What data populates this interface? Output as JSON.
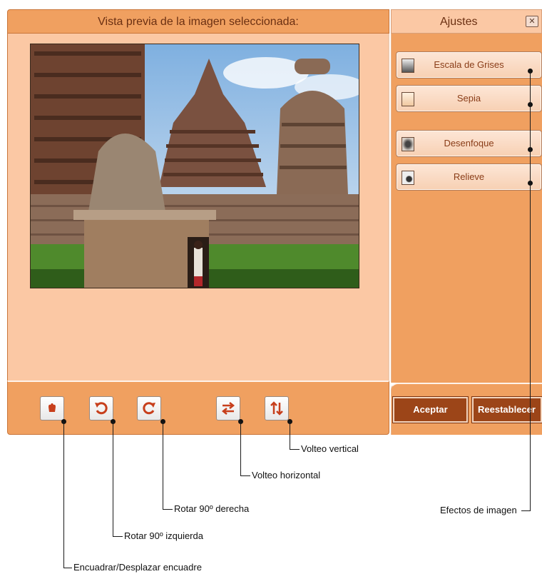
{
  "preview": {
    "title": "Vista previa de la imagen seleccionada:"
  },
  "settings": {
    "title": "Ajustes",
    "close_glyph": "✕",
    "effects": [
      {
        "label": "Escala de Grises",
        "icon": "grayscale-icon"
      },
      {
        "label": "Sepia",
        "icon": "sepia-icon"
      },
      {
        "label": "Desenfoque",
        "icon": "blur-icon"
      },
      {
        "label": "Relieve",
        "icon": "emboss-icon"
      }
    ],
    "accept_label": "Aceptar",
    "reset_label": "Reestablecer"
  },
  "toolbar": {
    "crop_icon": "crop-pan-icon",
    "rotate_left_icon": "rotate-left-icon",
    "rotate_right_icon": "rotate-right-icon",
    "flip_h_icon": "flip-horizontal-icon",
    "flip_v_icon": "flip-vertical-icon"
  },
  "annotations": {
    "flip_vertical": "Volteo vertical",
    "flip_horizontal": "Volteo horizontal",
    "rotate_right": "Rotar 90º derecha",
    "rotate_left": "Rotar 90º izquierda",
    "crop": "Encuadrar/Desplazar encuadre",
    "effects": "Efectos de imagen"
  },
  "colors": {
    "panel_orange": "#f0a060",
    "panel_peach": "#fbc8a4",
    "button_brown": "#9c4518",
    "icon_red": "#c73f1c"
  }
}
